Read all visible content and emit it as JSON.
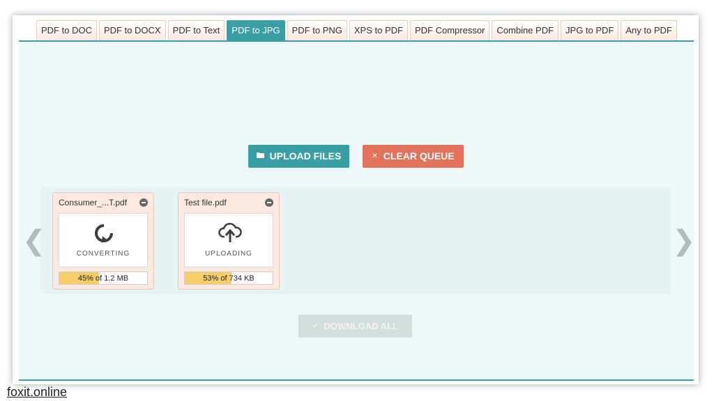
{
  "tabs": [
    {
      "label": "PDF to DOC",
      "active": false
    },
    {
      "label": "PDF to DOCX",
      "active": false
    },
    {
      "label": "PDF to Text",
      "active": false
    },
    {
      "label": "PDF to JPG",
      "active": true
    },
    {
      "label": "PDF to PNG",
      "active": false
    },
    {
      "label": "XPS to PDF",
      "active": false
    },
    {
      "label": "PDF Compressor",
      "active": false
    },
    {
      "label": "Combine PDF",
      "active": false
    },
    {
      "label": "JPG to PDF",
      "active": false
    },
    {
      "label": "Any to PDF",
      "active": false
    }
  ],
  "toolbar": {
    "upload_label": "UPLOAD FILES",
    "clear_label": "CLEAR QUEUE",
    "download_label": "DOWNLOAD ALL"
  },
  "icons": {
    "upload": "folder-icon",
    "clear": "close-icon",
    "download": "check-icon",
    "prev": "chevron-left-icon",
    "next": "chevron-right-icon"
  },
  "nav": {
    "prev": "❮",
    "next": "❯"
  },
  "files": [
    {
      "name": "Consumer_...T.pdf",
      "status": "CONVERTING",
      "status_icon": "refresh-icon",
      "progress_percent": 45,
      "progress_text": "45% of 1.2 MB"
    },
    {
      "name": "Test file.pdf",
      "status": "UPLOADING",
      "status_icon": "cloud-upload-icon",
      "progress_percent": 53,
      "progress_text": "53% of 734 KB"
    }
  ],
  "colors": {
    "accent": "#3a9fa5",
    "danger": "#e2725b",
    "progress": "#f7cd6a",
    "panel_bg": "#eef8f8"
  },
  "watermark": "foxit.online"
}
